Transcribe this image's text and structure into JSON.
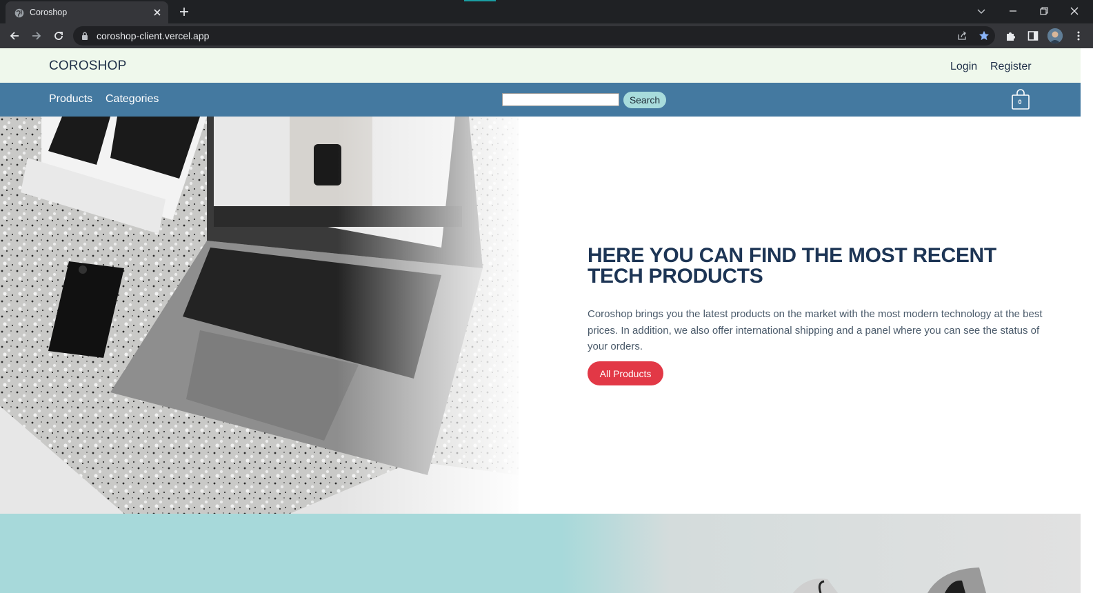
{
  "browser": {
    "tab_title": "Coroshop",
    "url": "coroshop-client.vercel.app"
  },
  "site": {
    "brand": "COROSHOP",
    "auth": {
      "login": "Login",
      "register": "Register"
    },
    "nav": {
      "products": "Products",
      "categories": "Categories"
    },
    "search": {
      "button_label": "Search",
      "value": ""
    },
    "cart": {
      "count": "0"
    }
  },
  "hero": {
    "title": "HERE YOU CAN FIND THE MOST RECENT TECH PRODUCTS",
    "description": "Coroshop brings you the latest products on the market with the most modern technology at the best prices. In addition, we also offer international shipping and a panel where you can see the status of your orders.",
    "button_label": "All Products"
  },
  "colors": {
    "header_bg": "#eff8ec",
    "nav_bg": "#4479a0",
    "accent_button": "#e23846",
    "search_button": "#a8dcdc",
    "title_color": "#1d3555",
    "strip_bg": "#a7d9da"
  },
  "icons": {
    "browser": [
      "globe-icon",
      "close-icon",
      "plus-icon",
      "back-icon",
      "forward-icon",
      "reload-icon",
      "lock-icon",
      "share-icon",
      "star-icon",
      "puzzle-icon",
      "sidepanel-icon",
      "menu-icon"
    ],
    "site": [
      "shopping-bag-icon"
    ]
  }
}
